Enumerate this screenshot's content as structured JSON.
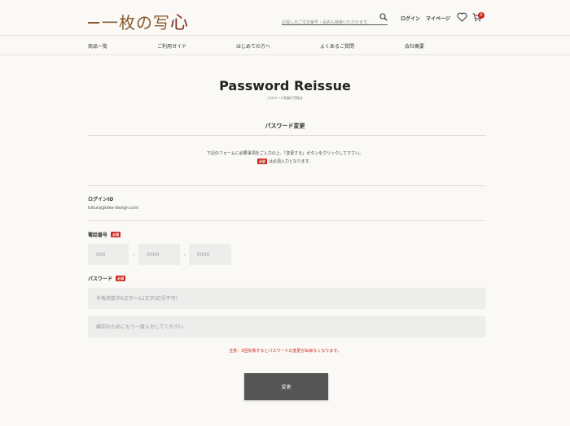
{
  "header": {
    "logo_prefix": "一枚の写",
    "logo_suffix": "心",
    "search_placeholder": "お探しのご注文番号・品名も検索いただけます。",
    "login_label": "ログイン",
    "mypage_label": "マイページ",
    "cart_count": "0"
  },
  "nav": {
    "items": [
      "商品一覧",
      "ご利用ガイド",
      "はじめての方へ",
      "よくあるご質問",
      "会社概要"
    ]
  },
  "page": {
    "title": "Password Reissue",
    "subtitle": "パスワード再発行手続き",
    "section_title": "パスワード変更",
    "desc_line1": "下記のフォームに必要事項をご入力の上、「変更する」ボタンをクリックして下さい。",
    "required_badge": "必須",
    "desc_line2": "は必須入力となります。"
  },
  "form": {
    "login_id_label": "ログインID",
    "login_id_value": "tokura@idex-design.com",
    "phone_label": "電話番号",
    "phone_placeholders": [
      "000",
      "0000",
      "0000"
    ],
    "phone_separator": "-",
    "password_label": "パスワード",
    "password_placeholder": "半角英数字6文字〜12文字(記号不可)",
    "password_confirm_placeholder": "確認のためにもう一度入力してください",
    "note": "注意：3回失敗するとパスワードの変更が出来なくなります。",
    "submit_label": "変更"
  },
  "colors": {
    "accent_red": "#c8261c",
    "button_dark": "#555555",
    "logo_brown": "#8a5a2c"
  }
}
